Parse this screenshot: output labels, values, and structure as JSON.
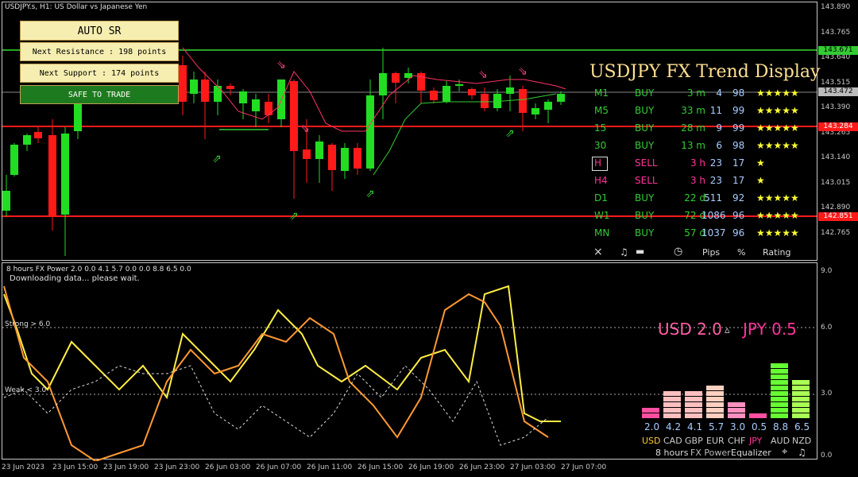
{
  "chart_header": {
    "title": "USDJPY.s, H1:  US Dollar vs Japanese Yen"
  },
  "sr_panel": {
    "title": "AUTO SR",
    "resistance": "Next Resistance : 198 points",
    "support": "Next Support : 174 points",
    "status": "SAFE TO TRADE"
  },
  "price_axis": [
    "143.890",
    "143.765",
    "143.640",
    "143.515",
    "143.390",
    "143.265",
    "143.140",
    "143.015",
    "142.890",
    "142.765"
  ],
  "price_tags": {
    "resistance": "143.671",
    "current": "143.472",
    "red_upper": "143.284",
    "red_lower": "142.851"
  },
  "trend_display": {
    "title": "USDJPY FX Trend Display",
    "rows": [
      {
        "tf": "M1",
        "signal": "BUY",
        "dur": "3 m",
        "pips": "4",
        "pct": "98",
        "stars": "★★★★★"
      },
      {
        "tf": "M5",
        "signal": "BUY",
        "dur": "33 m",
        "pips": "11",
        "pct": "99",
        "stars": "★★★★★"
      },
      {
        "tf": "15",
        "signal": "BUY",
        "dur": "28 m",
        "pips": "9",
        "pct": "99",
        "stars": "★★★★★"
      },
      {
        "tf": "30",
        "signal": "BUY",
        "dur": "13 m",
        "pips": "6",
        "pct": "98",
        "stars": "★★★★★"
      },
      {
        "tf": "H",
        "signal": "SELL",
        "dur": "3 h",
        "pips": "23",
        "pct": "17",
        "stars": "★"
      },
      {
        "tf": "H4",
        "signal": "SELL",
        "dur": "3 h",
        "pips": "23",
        "pct": "17",
        "stars": "★"
      },
      {
        "tf": "D1",
        "signal": "BUY",
        "dur": "22 d",
        "pips": "511",
        "pct": "92",
        "stars": "★★★★★"
      },
      {
        "tf": "W1",
        "signal": "BUY",
        "dur": "72 d",
        "pips": "1086",
        "pct": "96",
        "stars": "★★★★★"
      },
      {
        "tf": "MN",
        "signal": "BUY",
        "dur": "57 d",
        "pips": "1037",
        "pct": "96",
        "stars": "★★★★★"
      }
    ],
    "footer": {
      "close": "×",
      "sound": "♫",
      "clock": "◷",
      "pips": "Pips",
      "pct": "%",
      "rating": "Rating"
    },
    "colors": {
      "buy": "#33cc33",
      "sell": "#ff3399",
      "tf_buy": "#33cc33",
      "tf_sell": "#ff3399",
      "num": "#aaccff",
      "star": "#ffff33",
      "title": "#ffe090"
    }
  },
  "indicator": {
    "header": "8 hours FX Power 2.0 0.0 4.1 5.7 0.0 0.0 8.8 6.5 0.0",
    "status": "Downloading data... please wait.",
    "strong_label": "Strong > 6.0",
    "weak_label": "Weak < 3.0",
    "axis": [
      "9.0",
      "6.0",
      "3.0",
      "0.0"
    ],
    "usd_label": "USD 2.0",
    "jpy_label": "JPY 0.5",
    "arrow": "▵",
    "currencies": [
      {
        "name": "USD",
        "value": "2.0",
        "color": "#ff4fa0"
      },
      {
        "name": "CAD",
        "value": "4.2",
        "color": "#ffbfbf"
      },
      {
        "name": "GBP",
        "value": "4.1",
        "color": "#ffbfbf"
      },
      {
        "name": "EUR",
        "value": "5.7",
        "color": "#ffd0c0"
      },
      {
        "name": "CHF",
        "value": "3.0",
        "color": "#ff8fbf"
      },
      {
        "name": "JPY",
        "value": "0.5",
        "color": "#ff4fa0"
      },
      {
        "name": "AUD",
        "value": "8.8",
        "color": "#66ff33"
      },
      {
        "name": "NZD",
        "value": "6.5",
        "color": "#aaff55"
      }
    ],
    "footer": {
      "period": "8 hours",
      "name": "FX Power",
      "eq": "Equalizer"
    }
  },
  "time_axis": [
    "23 Jun 2023",
    "23 Jun 15:00",
    "23 Jun 19:00",
    "23 Jun 23:00",
    "26 Jun 03:00",
    "26 Jun 07:00",
    "26 Jun 11:00",
    "26 Jun 15:00",
    "26 Jun 19:00",
    "26 Jun 23:00",
    "27 Jun 03:00",
    "27 Jun 07:00"
  ]
}
